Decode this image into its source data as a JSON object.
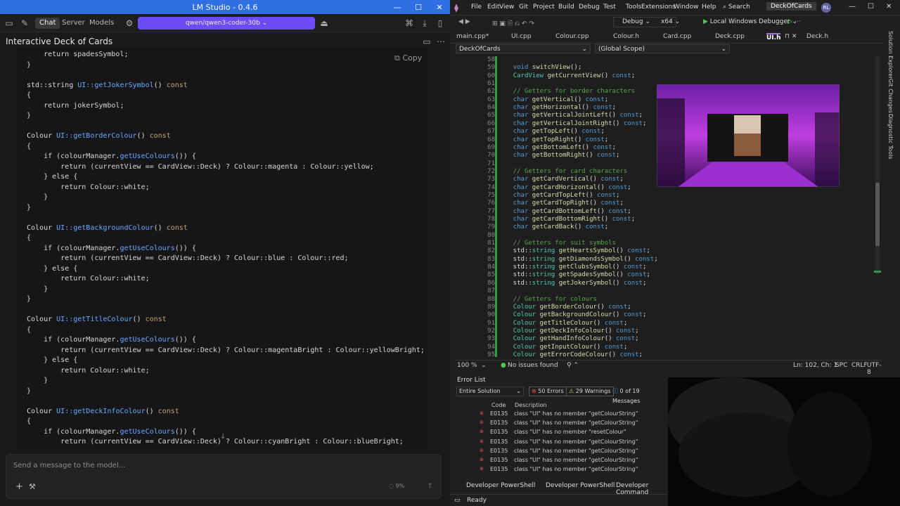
{
  "lm": {
    "title": "LM Studio - 0.4.6",
    "tabs": [
      "Chat",
      "Server",
      "Models"
    ],
    "model": "qwen/qwen3-coder-30b",
    "chat_title": "Interactive Deck of Cards",
    "copy_label": "Copy",
    "composer_placeholder": "Send a message to the model...",
    "progress": "9%",
    "code": [
      "    return spadesSymbol;",
      "}",
      "",
      "std::string UI::getJokerSymbol() const",
      "{",
      "    return jokerSymbol;",
      "}",
      "",
      "Colour UI::getBorderColour() const",
      "{",
      "    if (colourManager.getUseColours()) {",
      "        return (currentView == CardView::Deck) ? Colour::magenta : Colour::yellow;",
      "    } else {",
      "        return Colour::white;",
      "    }",
      "}",
      "",
      "Colour UI::getBackgroundColour() const",
      "{",
      "    if (colourManager.getUseColours()) {",
      "        return (currentView == CardView::Deck) ? Colour::blue : Colour::red;",
      "    } else {",
      "        return Colour::white;",
      "    }",
      "}",
      "",
      "Colour UI::getTitleColour() const",
      "{",
      "    if (colourManager.getUseColours()) {",
      "        return (currentView == CardView::Deck) ? Colour::magentaBright : Colour::yellowBright;",
      "    } else {",
      "        return Colour::white;",
      "    }",
      "}",
      "",
      "Colour UI::getDeckInfoColour() const",
      "{",
      "    if (colourManager.getUseColours()) {",
      "        return (currentView == CardView::Deck) ? Colour::cyanBright : Colour::blueBright;"
    ]
  },
  "vs": {
    "menu": [
      "File",
      "Edit",
      "View",
      "Git",
      "Project",
      "Build",
      "Debug",
      "Test",
      "Tools",
      "Extensions",
      "Window",
      "Help"
    ],
    "search": "Search",
    "project": "DeckOfCards",
    "avatar": "RL",
    "config": "Debug",
    "platform": "x64",
    "debugger": "Local Windows Debugger",
    "tabs": [
      "main.cpp*",
      "UI.cpp",
      "Colour.cpp",
      "Colour.h",
      "Card.cpp",
      "Deck.cpp",
      "UI.h",
      "Deck.h"
    ],
    "active_tab": "UI.h",
    "nav_left": "DeckOfCards",
    "nav_right": "(Global Scope)",
    "side_tabs": [
      "Solution Explorer",
      "Git Changes",
      "Diagnostic Tools"
    ],
    "line_numbers": [
      "58",
      "59",
      "60",
      "61",
      "62",
      "63",
      "64",
      "65",
      "66",
      "67",
      "68",
      "69",
      "70",
      "71",
      "72",
      "73",
      "74",
      "75",
      "76",
      "77",
      "78",
      "79",
      "80",
      "81",
      "82",
      "83",
      "84",
      "85",
      "86",
      "87",
      "88",
      "89",
      "90",
      "91",
      "92",
      "93",
      "94",
      "95"
    ],
    "zoom": "100 %",
    "issues": "No issues found",
    "cursor": "Ln: 102, Ch: 1",
    "spc": "SPC",
    "crlf": "CRLF",
    "encoding": "UTF-8",
    "error_list_title": "Error List",
    "scope": "Entire Solution",
    "errors": "50 Errors",
    "warnings": "29 Warnings",
    "messages": "0 of 19 Messages",
    "col_code": "Code",
    "col_desc": "Description",
    "err_rows": [
      {
        "code": "E0135",
        "desc": "class \"UI\" has no member \"getColourString\""
      },
      {
        "code": "E0135",
        "desc": "class \"UI\" has no member \"getColourString\""
      },
      {
        "code": "E0135",
        "desc": "class \"UI\" has no member \"resetColour\""
      },
      {
        "code": "E0135",
        "desc": "class \"UI\" has no member \"getColourString\""
      },
      {
        "code": "E0135",
        "desc": "class \"UI\" has no member \"getColourString\""
      },
      {
        "code": "E0135",
        "desc": "class \"UI\" has no member \"getColourString\""
      },
      {
        "code": "E0135",
        "desc": "class \"UI\" has no member \"getColourString\""
      }
    ],
    "ps_tabs": [
      "Developer PowerShell",
      "Developer PowerShell",
      "Developer Command"
    ],
    "status": "Ready"
  }
}
